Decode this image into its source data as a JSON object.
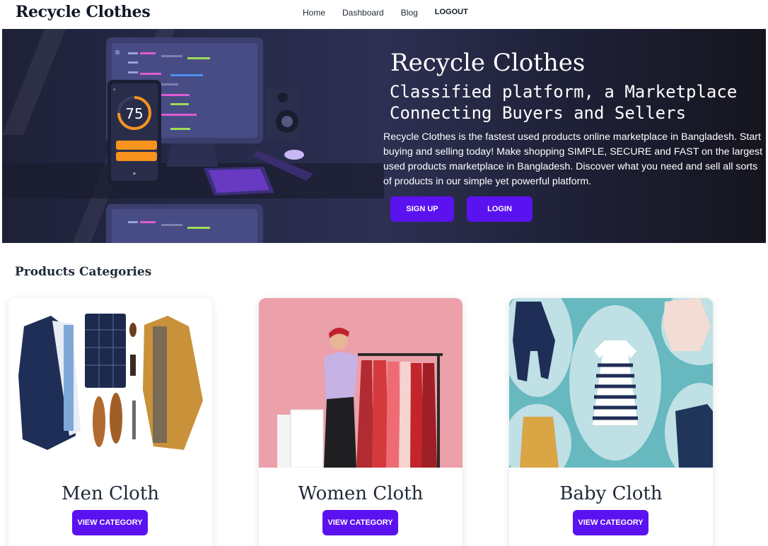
{
  "nav": {
    "brand": "Recycle Clothes",
    "links": [
      "Home",
      "Dashboard",
      "Blog"
    ],
    "logout": "LOGOUT"
  },
  "hero": {
    "title": "Recycle Clothes",
    "subtitle_line1": "Classified platform, a Marketplace",
    "subtitle_line2": "Connecting Buyers and Sellers",
    "description": "Recycle Clothes is the fastest used products online marketplace in Bangladesh. Start buying and selling today! Make shopping SIMPLE, SECURE and FAST on the largest used products marketplace in Bangladesh. Discover what you need and sell all sorts of products in our simple yet powerful platform.",
    "phone_score": "75",
    "signup_label": "SIGN UP",
    "login_label": "LOGIN"
  },
  "categories": {
    "title": "Products Categories",
    "items": [
      {
        "name": "Men Cloth",
        "button": "VIEW CATEGORY",
        "image_icon": "men-clothing-image"
      },
      {
        "name": "Women Cloth",
        "button": "VIEW CATEGORY",
        "image_icon": "women-clothing-image"
      },
      {
        "name": "Baby Cloth",
        "button": "VIEW CATEGORY",
        "image_icon": "baby-clothing-image"
      }
    ]
  },
  "colors": {
    "accent": "#5b12f0",
    "hero_bg": "#262a49",
    "text": "#1f2937"
  }
}
